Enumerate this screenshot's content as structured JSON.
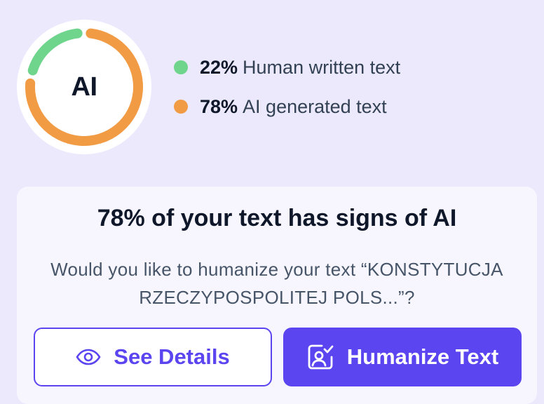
{
  "gauge": {
    "label": "AI",
    "human_percent": 22,
    "ai_percent": 78,
    "human_color": "#6fd48c",
    "ai_color": "#f29b45"
  },
  "legend": [
    {
      "percent": "22%",
      "text": "Human written text",
      "color": "#6fd48c"
    },
    {
      "percent": "78%",
      "text": "AI generated text",
      "color": "#f29b45"
    }
  ],
  "card": {
    "title": "78% of your text has signs of AI",
    "question_line1": "Would you like to humanize your text “KONSTYTUCJA",
    "question_line2": "RZECZYPOSPOLITEJ POLS...”?",
    "see_details_label": "See Details",
    "see_details_icon": "eye-icon",
    "humanize_label": "Humanize Text",
    "humanize_icon": "user-check-icon",
    "accent_color": "#5b45f0"
  }
}
